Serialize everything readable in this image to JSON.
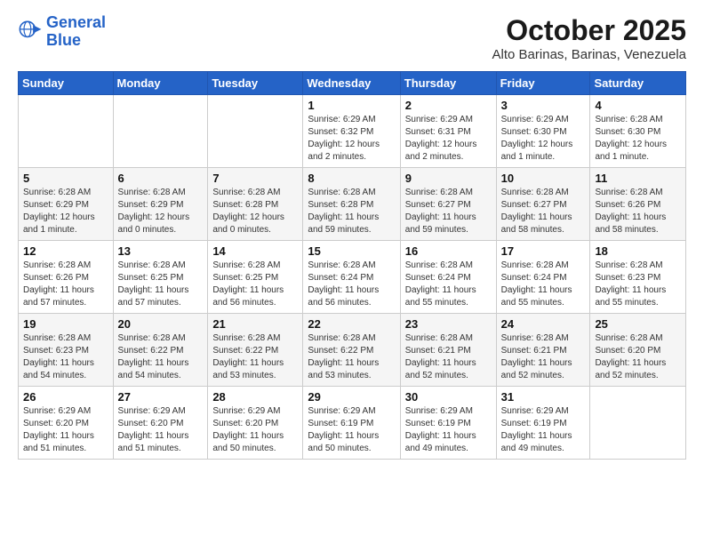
{
  "header": {
    "logo_general": "General",
    "logo_blue": "Blue",
    "month": "October 2025",
    "location": "Alto Barinas, Barinas, Venezuela"
  },
  "days_of_week": [
    "Sunday",
    "Monday",
    "Tuesday",
    "Wednesday",
    "Thursday",
    "Friday",
    "Saturday"
  ],
  "weeks": [
    [
      {
        "day": "",
        "info": ""
      },
      {
        "day": "",
        "info": ""
      },
      {
        "day": "",
        "info": ""
      },
      {
        "day": "1",
        "info": "Sunrise: 6:29 AM\nSunset: 6:32 PM\nDaylight: 12 hours\nand 2 minutes."
      },
      {
        "day": "2",
        "info": "Sunrise: 6:29 AM\nSunset: 6:31 PM\nDaylight: 12 hours\nand 2 minutes."
      },
      {
        "day": "3",
        "info": "Sunrise: 6:29 AM\nSunset: 6:30 PM\nDaylight: 12 hours\nand 1 minute."
      },
      {
        "day": "4",
        "info": "Sunrise: 6:28 AM\nSunset: 6:30 PM\nDaylight: 12 hours\nand 1 minute."
      }
    ],
    [
      {
        "day": "5",
        "info": "Sunrise: 6:28 AM\nSunset: 6:29 PM\nDaylight: 12 hours\nand 1 minute."
      },
      {
        "day": "6",
        "info": "Sunrise: 6:28 AM\nSunset: 6:29 PM\nDaylight: 12 hours\nand 0 minutes."
      },
      {
        "day": "7",
        "info": "Sunrise: 6:28 AM\nSunset: 6:28 PM\nDaylight: 12 hours\nand 0 minutes."
      },
      {
        "day": "8",
        "info": "Sunrise: 6:28 AM\nSunset: 6:28 PM\nDaylight: 11 hours\nand 59 minutes."
      },
      {
        "day": "9",
        "info": "Sunrise: 6:28 AM\nSunset: 6:27 PM\nDaylight: 11 hours\nand 59 minutes."
      },
      {
        "day": "10",
        "info": "Sunrise: 6:28 AM\nSunset: 6:27 PM\nDaylight: 11 hours\nand 58 minutes."
      },
      {
        "day": "11",
        "info": "Sunrise: 6:28 AM\nSunset: 6:26 PM\nDaylight: 11 hours\nand 58 minutes."
      }
    ],
    [
      {
        "day": "12",
        "info": "Sunrise: 6:28 AM\nSunset: 6:26 PM\nDaylight: 11 hours\nand 57 minutes."
      },
      {
        "day": "13",
        "info": "Sunrise: 6:28 AM\nSunset: 6:25 PM\nDaylight: 11 hours\nand 57 minutes."
      },
      {
        "day": "14",
        "info": "Sunrise: 6:28 AM\nSunset: 6:25 PM\nDaylight: 11 hours\nand 56 minutes."
      },
      {
        "day": "15",
        "info": "Sunrise: 6:28 AM\nSunset: 6:24 PM\nDaylight: 11 hours\nand 56 minutes."
      },
      {
        "day": "16",
        "info": "Sunrise: 6:28 AM\nSunset: 6:24 PM\nDaylight: 11 hours\nand 55 minutes."
      },
      {
        "day": "17",
        "info": "Sunrise: 6:28 AM\nSunset: 6:24 PM\nDaylight: 11 hours\nand 55 minutes."
      },
      {
        "day": "18",
        "info": "Sunrise: 6:28 AM\nSunset: 6:23 PM\nDaylight: 11 hours\nand 55 minutes."
      }
    ],
    [
      {
        "day": "19",
        "info": "Sunrise: 6:28 AM\nSunset: 6:23 PM\nDaylight: 11 hours\nand 54 minutes."
      },
      {
        "day": "20",
        "info": "Sunrise: 6:28 AM\nSunset: 6:22 PM\nDaylight: 11 hours\nand 54 minutes."
      },
      {
        "day": "21",
        "info": "Sunrise: 6:28 AM\nSunset: 6:22 PM\nDaylight: 11 hours\nand 53 minutes."
      },
      {
        "day": "22",
        "info": "Sunrise: 6:28 AM\nSunset: 6:22 PM\nDaylight: 11 hours\nand 53 minutes."
      },
      {
        "day": "23",
        "info": "Sunrise: 6:28 AM\nSunset: 6:21 PM\nDaylight: 11 hours\nand 52 minutes."
      },
      {
        "day": "24",
        "info": "Sunrise: 6:28 AM\nSunset: 6:21 PM\nDaylight: 11 hours\nand 52 minutes."
      },
      {
        "day": "25",
        "info": "Sunrise: 6:28 AM\nSunset: 6:20 PM\nDaylight: 11 hours\nand 52 minutes."
      }
    ],
    [
      {
        "day": "26",
        "info": "Sunrise: 6:29 AM\nSunset: 6:20 PM\nDaylight: 11 hours\nand 51 minutes."
      },
      {
        "day": "27",
        "info": "Sunrise: 6:29 AM\nSunset: 6:20 PM\nDaylight: 11 hours\nand 51 minutes."
      },
      {
        "day": "28",
        "info": "Sunrise: 6:29 AM\nSunset: 6:20 PM\nDaylight: 11 hours\nand 50 minutes."
      },
      {
        "day": "29",
        "info": "Sunrise: 6:29 AM\nSunset: 6:19 PM\nDaylight: 11 hours\nand 50 minutes."
      },
      {
        "day": "30",
        "info": "Sunrise: 6:29 AM\nSunset: 6:19 PM\nDaylight: 11 hours\nand 49 minutes."
      },
      {
        "day": "31",
        "info": "Sunrise: 6:29 AM\nSunset: 6:19 PM\nDaylight: 11 hours\nand 49 minutes."
      },
      {
        "day": "",
        "info": ""
      }
    ]
  ]
}
